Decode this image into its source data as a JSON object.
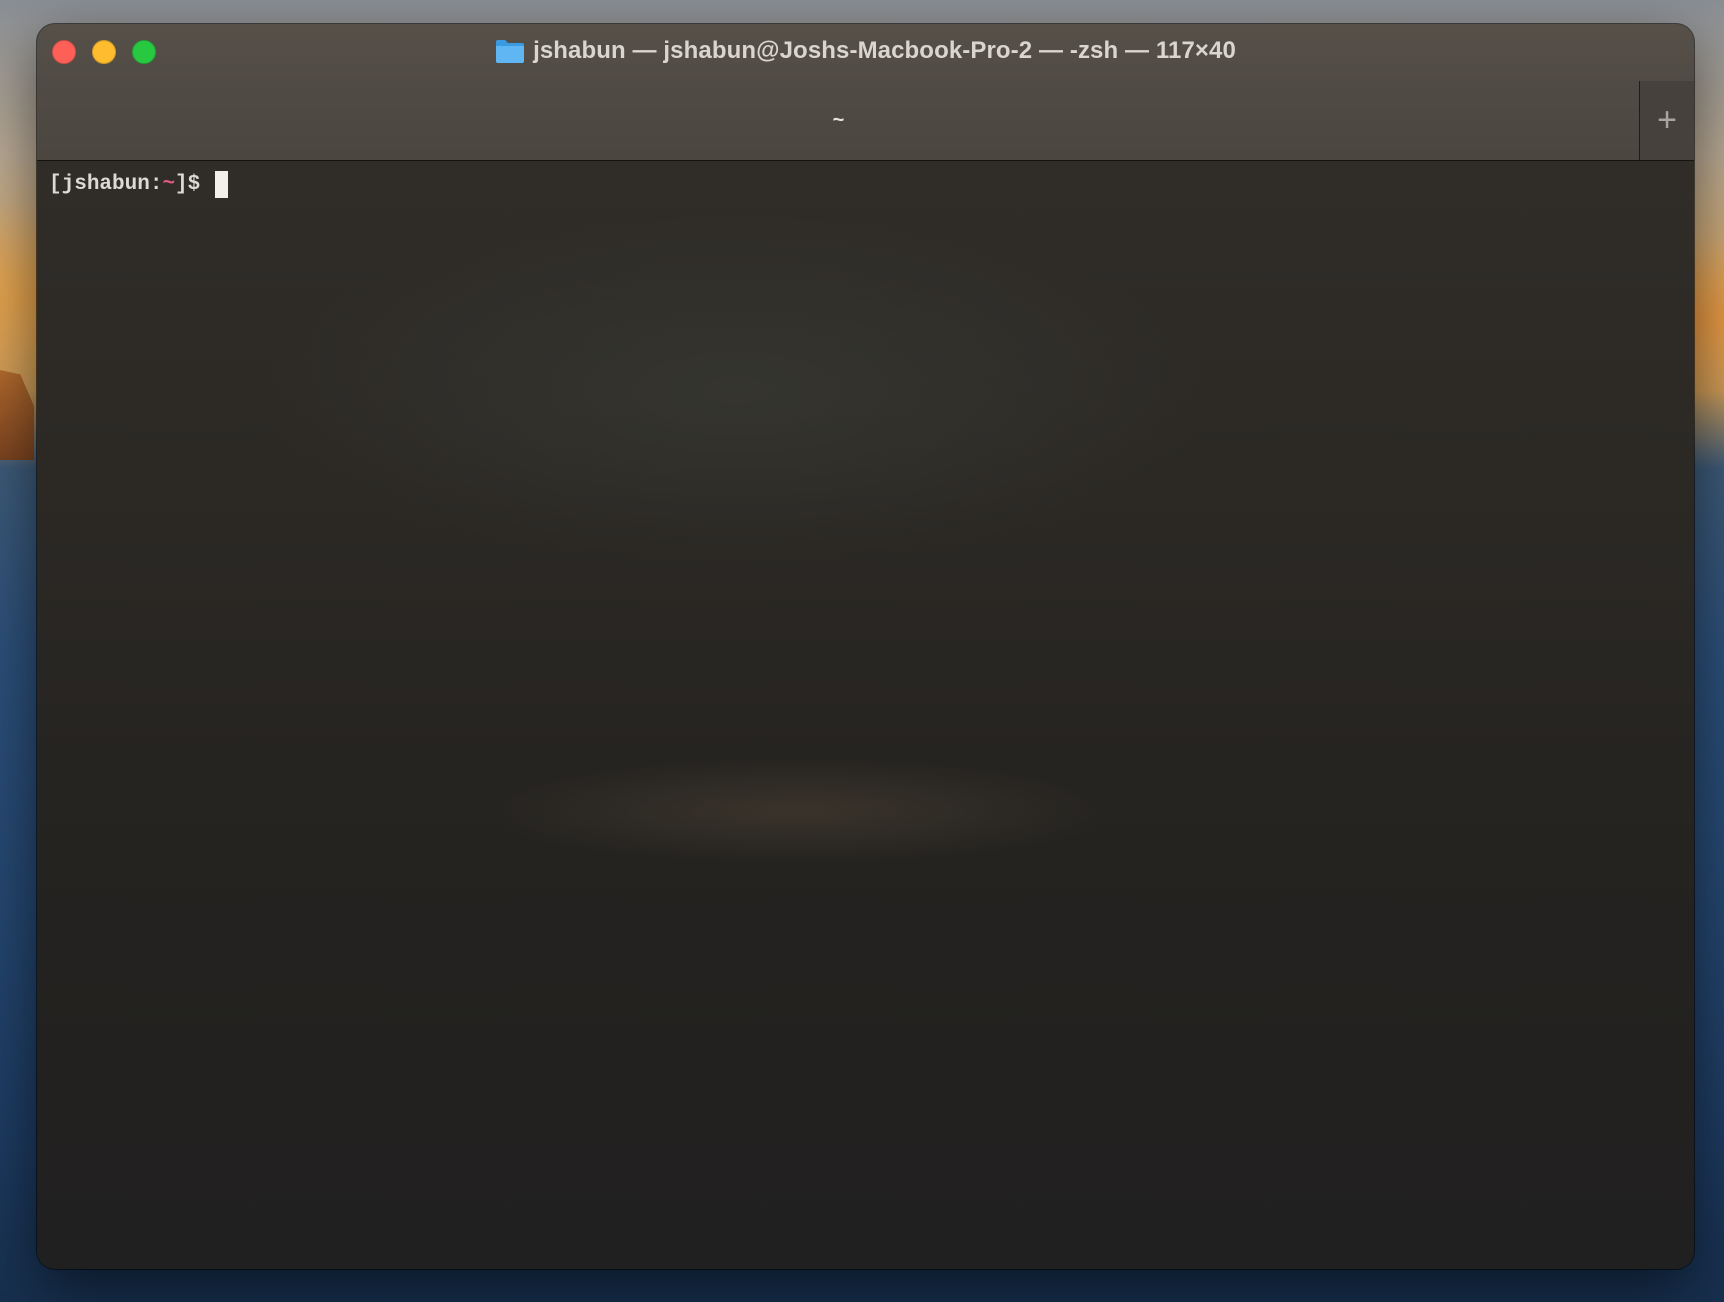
{
  "window": {
    "title": "jshabun — jshabun@Joshs-Macbook-Pro-2 — -zsh — 117×40",
    "title_icon": "folder-icon",
    "controls": {
      "close_color": "#fe5f57",
      "minimize_color": "#febc2e",
      "maximize_color": "#28c840"
    }
  },
  "tabs": [
    {
      "label": "~",
      "active": true
    }
  ],
  "new_tab_label": "+",
  "terminal": {
    "prompt": {
      "open_bracket": "[",
      "user": "jshabun",
      "separator": ":",
      "path": "~",
      "close_bracket": "]",
      "symbol": "$ "
    },
    "input": "",
    "colors": {
      "text": "#dcdad6",
      "path": "#e2587f",
      "cursor": "#f2f0ec"
    }
  }
}
